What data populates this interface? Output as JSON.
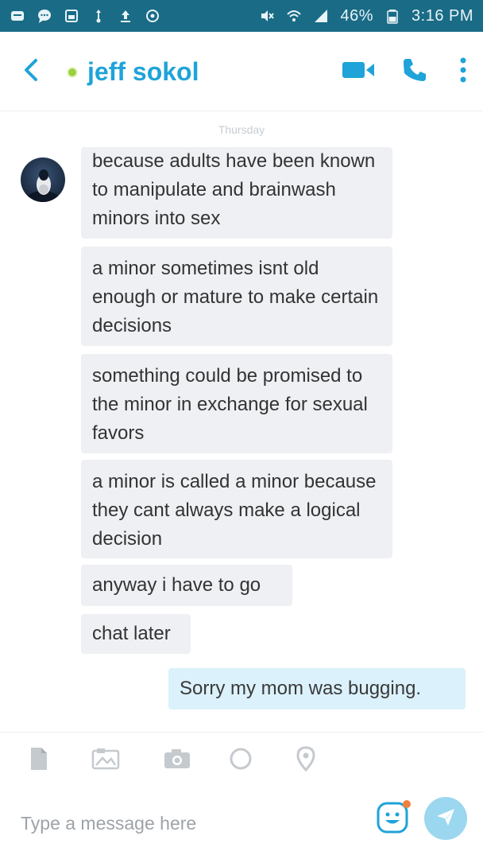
{
  "status_bar": {
    "battery": "46%",
    "time": "3:16 PM",
    "left_icons": [
      "message-icon",
      "chat-bubble-icon",
      "sim-icon",
      "usb-icon",
      "upload-icon",
      "sync-icon"
    ],
    "right_icons": [
      "mute-icon",
      "wifi-icon",
      "signal-icon",
      "battery-icon"
    ]
  },
  "header": {
    "contact_name": "jeff sokol",
    "presence_color": "#9bd13e",
    "accent_color": "#1fa3d8",
    "icons": [
      "back-icon",
      "video-call-icon",
      "phone-icon",
      "more-vertical-icon"
    ]
  },
  "conversation": {
    "day_label": "Thursday",
    "incoming": [
      {
        "text": "because adults have been known to manipulate and brainwash minors into sex"
      },
      {
        "text": "a minor sometimes isnt old enough or mature to make certain decisions"
      },
      {
        "text": "something could be promised to the minor in exchange for sexual favors"
      },
      {
        "text": "a minor is called a minor because they cant always make a logical decision"
      },
      {
        "text": "anyway i have to go"
      },
      {
        "text": "chat later"
      }
    ],
    "outgoing": [
      {
        "text": "Sorry my mom was bugging."
      }
    ],
    "incoming_bubble_color": "#eef0f3",
    "outgoing_bubble_color": "#dbf1fb"
  },
  "composer": {
    "placeholder": "Type a message here",
    "attach_icons": [
      "file-icon",
      "media-icon",
      "camera-icon",
      "emoticon-circle-icon",
      "location-icon"
    ],
    "emoji_icon": "smiley-icon",
    "send_icon": "send-icon"
  }
}
